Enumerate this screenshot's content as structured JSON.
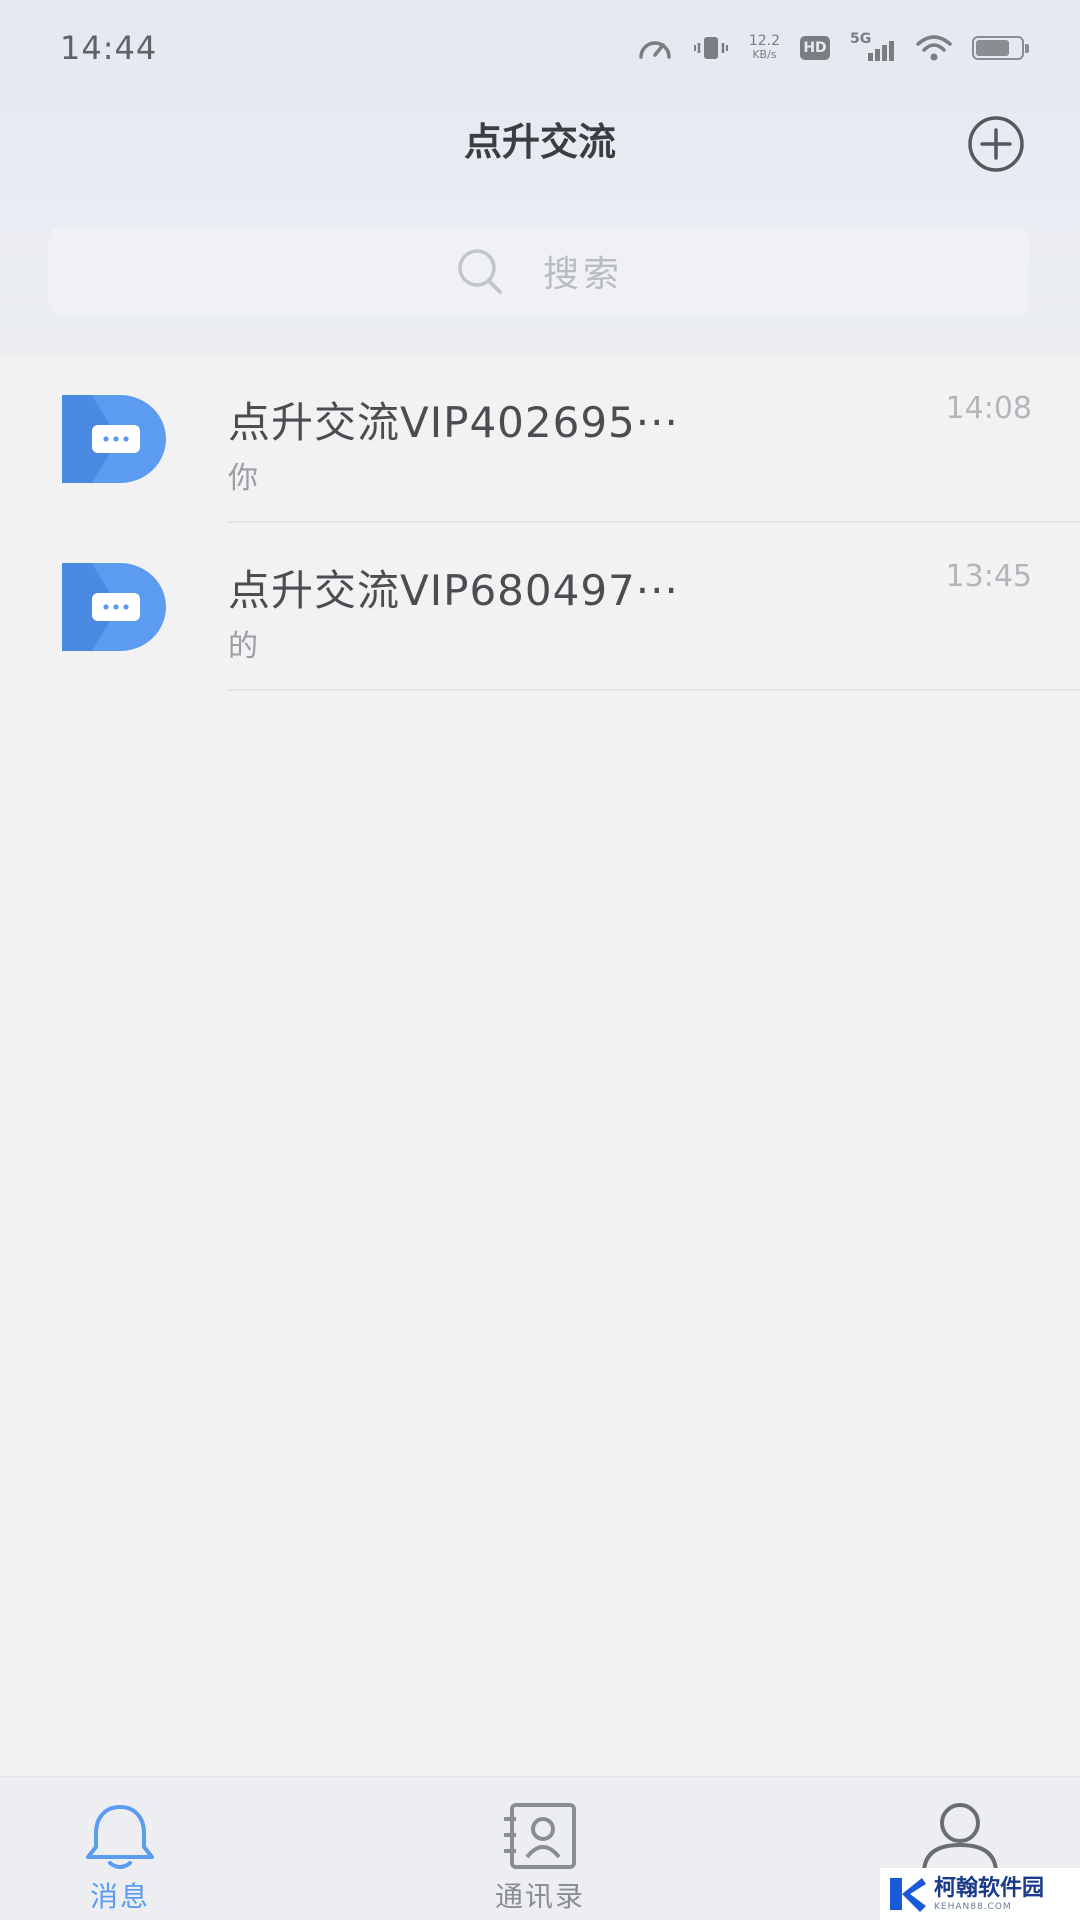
{
  "status_bar": {
    "time": "14:44",
    "net_speed_value": "12.2",
    "net_speed_unit": "KB/s",
    "hd_label": "HD",
    "network_label": "5G",
    "battery_level": 0.75,
    "icons": [
      "speedometer-icon",
      "vibrate-icon",
      "hd-icon",
      "signal-icon",
      "wifi-icon",
      "battery-icon"
    ]
  },
  "header": {
    "title": "点升交流",
    "add_icon": "plus-circle-icon"
  },
  "search": {
    "placeholder": "搜索",
    "icon": "search-icon"
  },
  "conversations": [
    {
      "name": "点升交流VIP402695···",
      "preview": "你",
      "time": "14:08",
      "avatar": "app-logo-avatar"
    },
    {
      "name": "点升交流VIP680497···",
      "preview": "的",
      "time": "13:45",
      "avatar": "app-logo-avatar"
    }
  ],
  "tabs": [
    {
      "label": "消息",
      "icon": "bell-icon",
      "active": true
    },
    {
      "label": "通讯录",
      "icon": "contacts-icon",
      "active": false
    },
    {
      "label": "",
      "icon": "user-icon",
      "active": false
    }
  ],
  "colors": {
    "accent": "#5b9bf0",
    "avatar_blue": "#4a90e8",
    "inactive_tab": "#8a8d92"
  },
  "watermark": {
    "main": "柯翰软件园",
    "sub": "KEHAN88.COM"
  }
}
